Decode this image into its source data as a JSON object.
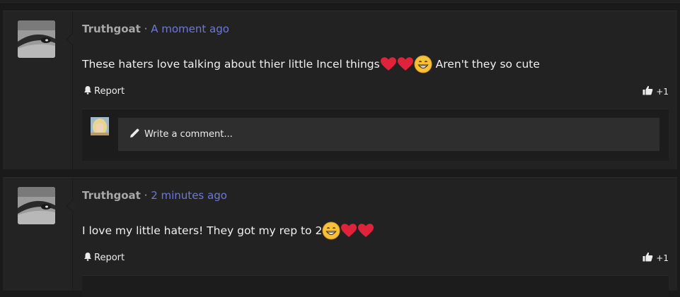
{
  "posts": [
    {
      "username": "Truthgoat",
      "separator": "·",
      "time": "A moment ago",
      "message_before": "These haters love talking about thier little Incel things",
      "emojis": [
        "red-heart",
        "red-heart",
        "grinning-face"
      ],
      "message_after": " Aren't they so cute",
      "report_label": "Report",
      "like_count": "+1",
      "comment_placeholder": "Write a comment..."
    },
    {
      "username": "Truthgoat",
      "separator": "·",
      "time": "2 minutes ago",
      "message_before": "I love my little haters! They got my rep to 2",
      "emojis": [
        "grinning-face",
        "red-heart",
        "red-heart"
      ],
      "report_label": "Report",
      "like_count": "+1"
    }
  ],
  "colors": {
    "background": "#1a1a1a",
    "panel": "#222222",
    "time_link": "#6f78d6",
    "heart": "#e0233a",
    "grin": "#f7c13a"
  }
}
